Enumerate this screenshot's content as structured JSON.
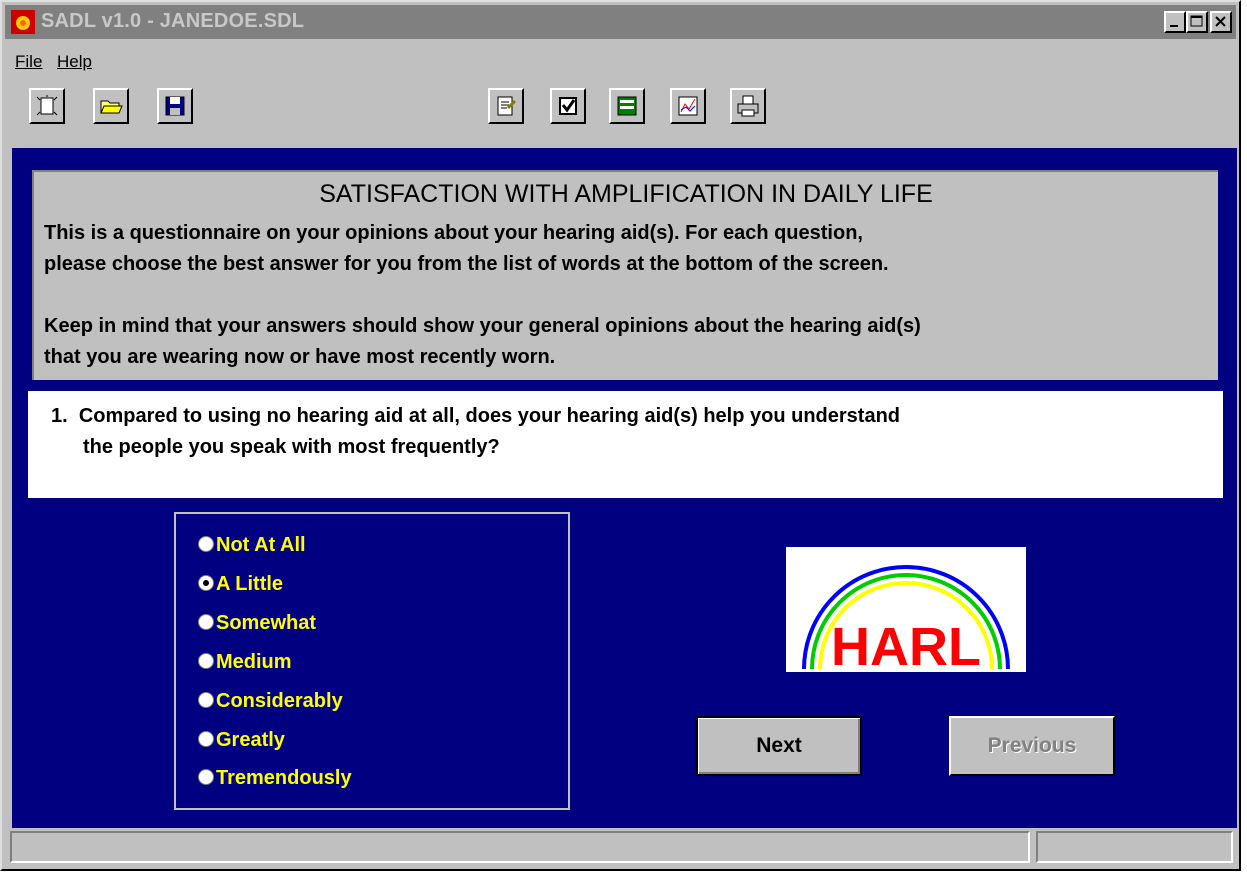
{
  "window": {
    "title": "SADL v1.0 - JANEDOE.SDL",
    "controls": [
      "minimize",
      "maximize",
      "close"
    ]
  },
  "menu": {
    "file": "File",
    "help": "Help"
  },
  "toolbar": {
    "left_tools": [
      "new-icon",
      "open-folder-icon",
      "save-icon"
    ],
    "right_tools": [
      "edit-document-icon",
      "checkbox-icon",
      "form-icon",
      "graph-icon",
      "print-icon"
    ]
  },
  "header": {
    "title": "SATISFACTION WITH AMPLIFICATION IN DAILY LIFE",
    "line1": "This is a questionnaire on your opinions about your hearing aid(s).  For each question,",
    "line2": "please choose the best answer for you from the list of words at the bottom of the screen.",
    "line3": "Keep in mind that your answers should show your general opinions about the hearing aid(s)",
    "line4": "that you are wearing now or have most recently worn."
  },
  "question": {
    "number": "1.",
    "line1": "Compared to using no hearing aid at all, does your hearing aid(s) help you understand",
    "line2": "the people you speak with most frequently?"
  },
  "options": [
    {
      "label": "Not At All",
      "checked": false
    },
    {
      "label": "A Little",
      "checked": true
    },
    {
      "label": "Somewhat",
      "checked": false
    },
    {
      "label": "Medium",
      "checked": false
    },
    {
      "label": "Considerably",
      "checked": false
    },
    {
      "label": "Greatly",
      "checked": false
    },
    {
      "label": "Tremendously",
      "checked": false
    }
  ],
  "logo": {
    "text": "HARL",
    "colors": {
      "text": "#ff0000",
      "arc_outer": "#0000ff",
      "arc_middle": "#00cc00",
      "arc_inner": "#ffff00"
    }
  },
  "buttons": {
    "next": "Next",
    "previous": "Previous"
  },
  "colors": {
    "client_bg": "#000080",
    "option_text": "#ffff00",
    "chrome": "#c0c0c0"
  }
}
